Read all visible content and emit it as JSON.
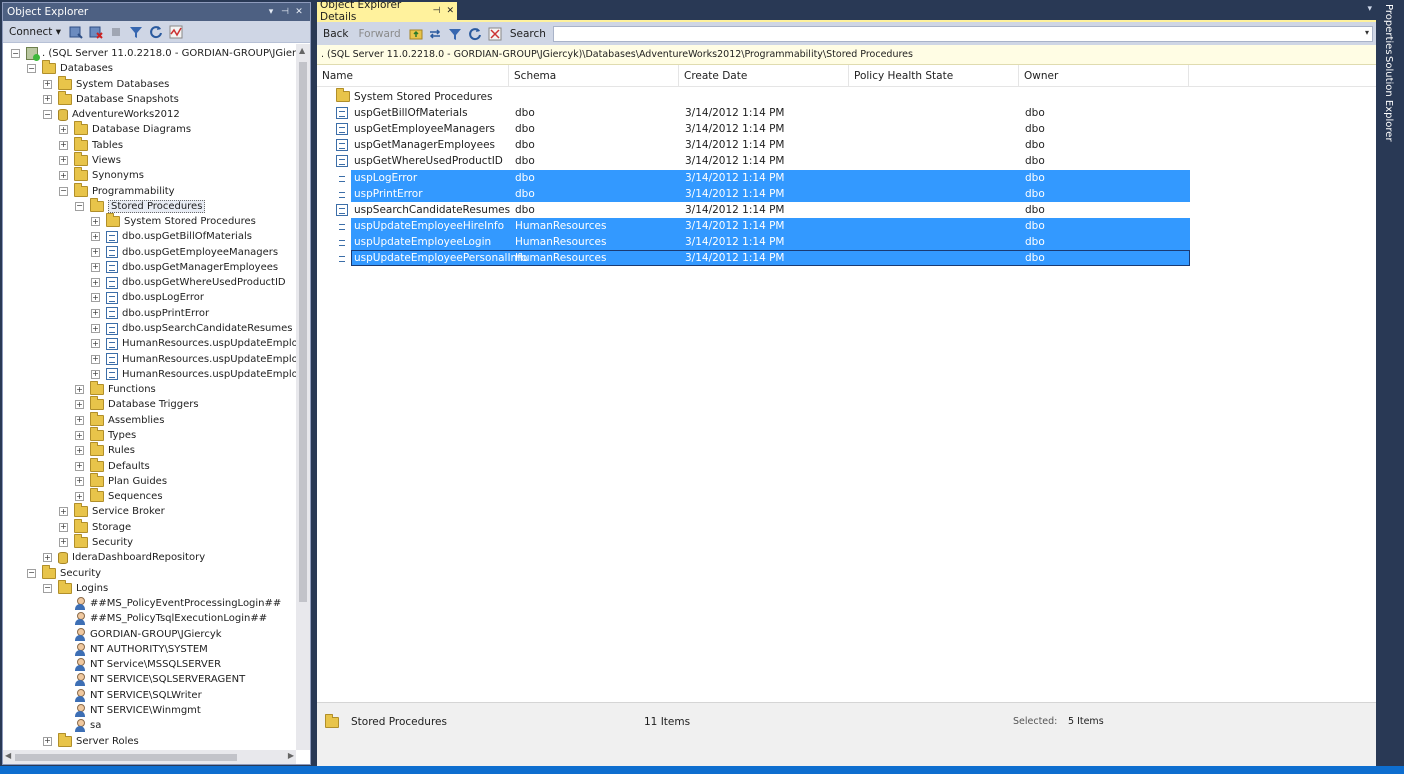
{
  "object_explorer": {
    "title": "Object Explorer",
    "title_buttons": [
      "▾",
      "⊣",
      "✕"
    ],
    "connect_label": "Connect ▾",
    "tree": [
      {
        "label": ". (SQL Server 11.0.2218.0 - GORDIAN-GROUP\\JGiercyk)",
        "icon": "server-icon",
        "expander": "−",
        "level": 0
      },
      {
        "label": "Databases",
        "icon": "folder-icon",
        "expander": "−",
        "level": 1
      },
      {
        "label": "System Databases",
        "icon": "folder-icon",
        "expander": "+",
        "level": 2
      },
      {
        "label": "Database Snapshots",
        "icon": "folder-icon",
        "expander": "+",
        "level": 2
      },
      {
        "label": "AdventureWorks2012",
        "icon": "database-icon",
        "expander": "−",
        "level": 2
      },
      {
        "label": "Database Diagrams",
        "icon": "folder-icon",
        "expander": "+",
        "level": 3
      },
      {
        "label": "Tables",
        "icon": "folder-icon",
        "expander": "+",
        "level": 3
      },
      {
        "label": "Views",
        "icon": "folder-icon",
        "expander": "+",
        "level": 3
      },
      {
        "label": "Synonyms",
        "icon": "folder-icon",
        "expander": "+",
        "level": 3
      },
      {
        "label": "Programmability",
        "icon": "folder-icon",
        "expander": "−",
        "level": 3
      },
      {
        "label": "Stored Procedures",
        "icon": "folder-icon",
        "expander": "−",
        "level": 4,
        "selected": true
      },
      {
        "label": "System Stored Procedures",
        "icon": "folder-icon",
        "expander": "+",
        "level": 5
      },
      {
        "label": "dbo.uspGetBillOfMaterials",
        "icon": "stored-procedure-icon",
        "expander": "+",
        "level": 5
      },
      {
        "label": "dbo.uspGetEmployeeManagers",
        "icon": "stored-procedure-icon",
        "expander": "+",
        "level": 5
      },
      {
        "label": "dbo.uspGetManagerEmployees",
        "icon": "stored-procedure-icon",
        "expander": "+",
        "level": 5
      },
      {
        "label": "dbo.uspGetWhereUsedProductID",
        "icon": "stored-procedure-icon",
        "expander": "+",
        "level": 5
      },
      {
        "label": "dbo.uspLogError",
        "icon": "stored-procedure-icon",
        "expander": "+",
        "level": 5
      },
      {
        "label": "dbo.uspPrintError",
        "icon": "stored-procedure-icon",
        "expander": "+",
        "level": 5
      },
      {
        "label": "dbo.uspSearchCandidateResumes",
        "icon": "stored-procedure-icon",
        "expander": "+",
        "level": 5
      },
      {
        "label": "HumanResources.uspUpdateEmployee",
        "icon": "stored-procedure-icon",
        "expander": "+",
        "level": 5
      },
      {
        "label": "HumanResources.uspUpdateEmployee",
        "icon": "stored-procedure-icon",
        "expander": "+",
        "level": 5
      },
      {
        "label": "HumanResources.uspUpdateEmployee",
        "icon": "stored-procedure-icon",
        "expander": "+",
        "level": 5
      },
      {
        "label": "Functions",
        "icon": "folder-icon",
        "expander": "+",
        "level": 4
      },
      {
        "label": "Database Triggers",
        "icon": "folder-icon",
        "expander": "+",
        "level": 4
      },
      {
        "label": "Assemblies",
        "icon": "folder-icon",
        "expander": "+",
        "level": 4
      },
      {
        "label": "Types",
        "icon": "folder-icon",
        "expander": "+",
        "level": 4
      },
      {
        "label": "Rules",
        "icon": "folder-icon",
        "expander": "+",
        "level": 4
      },
      {
        "label": "Defaults",
        "icon": "folder-icon",
        "expander": "+",
        "level": 4
      },
      {
        "label": "Plan Guides",
        "icon": "folder-icon",
        "expander": "+",
        "level": 4
      },
      {
        "label": "Sequences",
        "icon": "folder-icon",
        "expander": "+",
        "level": 4
      },
      {
        "label": "Service Broker",
        "icon": "folder-icon",
        "expander": "+",
        "level": 3
      },
      {
        "label": "Storage",
        "icon": "folder-icon",
        "expander": "+",
        "level": 3
      },
      {
        "label": "Security",
        "icon": "folder-icon",
        "expander": "+",
        "level": 3
      },
      {
        "label": "IderaDashboardRepository",
        "icon": "database-icon",
        "expander": "+",
        "level": 2
      },
      {
        "label": "Security",
        "icon": "folder-icon",
        "expander": "−",
        "level": 1
      },
      {
        "label": "Logins",
        "icon": "folder-icon",
        "expander": "−",
        "level": 2
      },
      {
        "label": "##MS_PolicyEventProcessingLogin##",
        "icon": "login-user-icon",
        "expander": "",
        "level": 3
      },
      {
        "label": "##MS_PolicyTsqlExecutionLogin##",
        "icon": "login-user-icon",
        "expander": "",
        "level": 3
      },
      {
        "label": "GORDIAN-GROUP\\JGiercyk",
        "icon": "login-user-icon",
        "expander": "",
        "level": 3
      },
      {
        "label": "NT AUTHORITY\\SYSTEM",
        "icon": "login-user-icon",
        "expander": "",
        "level": 3
      },
      {
        "label": "NT Service\\MSSQLSERVER",
        "icon": "login-user-icon",
        "expander": "",
        "level": 3
      },
      {
        "label": "NT SERVICE\\SQLSERVERAGENT",
        "icon": "login-user-icon",
        "expander": "",
        "level": 3
      },
      {
        "label": "NT SERVICE\\SQLWriter",
        "icon": "login-user-icon",
        "expander": "",
        "level": 3
      },
      {
        "label": "NT SERVICE\\Winmgmt",
        "icon": "login-user-icon",
        "expander": "",
        "level": 3
      },
      {
        "label": "sa",
        "icon": "login-user-icon",
        "expander": "",
        "level": 3
      },
      {
        "label": "Server Roles",
        "icon": "folder-icon",
        "expander": "+",
        "level": 2
      }
    ]
  },
  "details": {
    "tab_title": "Object Explorer Details",
    "pin_glyph": "⊣",
    "close_glyph": "✕",
    "toolbar": {
      "back": "Back",
      "forward": "Forward",
      "search_label": "Search",
      "search_value": ""
    },
    "breadcrumb": ". (SQL Server 11.0.2218.0 - GORDIAN-GROUP\\JGiercyk)\\Databases\\AdventureWorks2012\\Programmability\\Stored Procedures",
    "columns": [
      "Name",
      "Schema",
      "Create Date",
      "Policy Health State",
      "Owner"
    ],
    "rows": [
      {
        "name": "System Stored Procedures",
        "schema": "",
        "created": "",
        "policy": "",
        "owner": "",
        "icon": "folder-icon",
        "selected": false
      },
      {
        "name": "uspGetBillOfMaterials",
        "schema": "dbo",
        "created": "3/14/2012 1:14 PM",
        "policy": "",
        "owner": "dbo",
        "icon": "stored-procedure-icon",
        "selected": false
      },
      {
        "name": "uspGetEmployeeManagers",
        "schema": "dbo",
        "created": "3/14/2012 1:14 PM",
        "policy": "",
        "owner": "dbo",
        "icon": "stored-procedure-icon",
        "selected": false
      },
      {
        "name": "uspGetManagerEmployees",
        "schema": "dbo",
        "created": "3/14/2012 1:14 PM",
        "policy": "",
        "owner": "dbo",
        "icon": "stored-procedure-icon",
        "selected": false
      },
      {
        "name": "uspGetWhereUsedProductID",
        "schema": "dbo",
        "created": "3/14/2012 1:14 PM",
        "policy": "",
        "owner": "dbo",
        "icon": "stored-procedure-icon",
        "selected": false
      },
      {
        "name": "uspLogError",
        "schema": "dbo",
        "created": "3/14/2012 1:14 PM",
        "policy": "",
        "owner": "dbo",
        "icon": "stored-procedure-icon",
        "selected": true
      },
      {
        "name": "uspPrintError",
        "schema": "dbo",
        "created": "3/14/2012 1:14 PM",
        "policy": "",
        "owner": "dbo",
        "icon": "stored-procedure-icon",
        "selected": true
      },
      {
        "name": "uspSearchCandidateResumes",
        "schema": "dbo",
        "created": "3/14/2012 1:14 PM",
        "policy": "",
        "owner": "dbo",
        "icon": "stored-procedure-icon",
        "selected": false
      },
      {
        "name": "uspUpdateEmployeeHireInfo",
        "schema": "HumanResources",
        "created": "3/14/2012 1:14 PM",
        "policy": "",
        "owner": "dbo",
        "icon": "stored-procedure-icon",
        "selected": true
      },
      {
        "name": "uspUpdateEmployeeLogin",
        "schema": "HumanResources",
        "created": "3/14/2012 1:14 PM",
        "policy": "",
        "owner": "dbo",
        "icon": "stored-procedure-icon",
        "selected": true
      },
      {
        "name": "uspUpdateEmployeePersonalInfo",
        "schema": "HumanResources",
        "created": "3/14/2012 1:14 PM",
        "policy": "",
        "owner": "dbo",
        "icon": "stored-procedure-icon",
        "selected": true,
        "focused": true
      }
    ],
    "status": {
      "folder": "Stored Procedures",
      "count": "11 Items",
      "selected_label": "Selected:",
      "selected_value": "5 Items"
    }
  },
  "side_tabs": [
    "Properties",
    "Solution Explorer"
  ],
  "colors": {
    "chrome": "#293955",
    "active_tab": "#fff29d",
    "selection": "#3399ff",
    "title_bar": "#4d6082"
  }
}
